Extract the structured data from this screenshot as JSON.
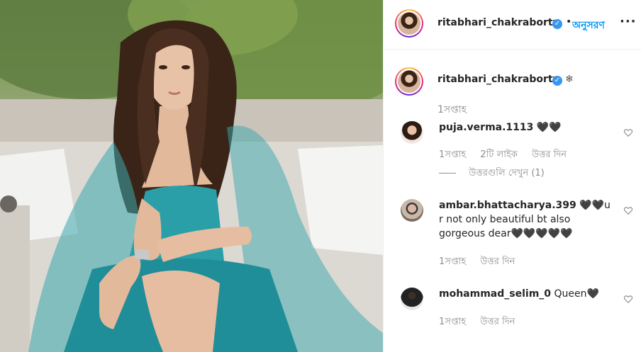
{
  "post": {
    "username": "ritabhari_chakraborty",
    "follow_label": "অনুসরণ",
    "more_label": "···",
    "caption_emoji": "❄",
    "caption_time": "1সপ্তাহ"
  },
  "comments": [
    {
      "username": "puja.verma.1113",
      "text": "🖤🖤",
      "time": "1সপ্তাহ",
      "likes": "2টি লাইক",
      "reply_label": "উত্তর দিন",
      "view_replies": "উত্তরগুলি দেখুন (1)"
    },
    {
      "username": "ambar.bhattacharya.399",
      "text": "🖤🖤u r not only beautiful bt also gorgeous dear🖤🖤🖤🖤🖤",
      "time": "1সপ্তাহ",
      "reply_label": "উত্তর দিন"
    },
    {
      "username": "mohammad_selim_0",
      "text": "Queen🖤",
      "time": "1সপ্তাহ",
      "reply_label": "উত্তর দিন"
    }
  ],
  "colors": {
    "accent": "#0095f6",
    "verified": "#3897f0",
    "dress": "#2a9fa8"
  },
  "icons": {
    "verified": "verified-badge-icon",
    "heart": "heart-outline-icon",
    "more": "more-options-icon"
  }
}
